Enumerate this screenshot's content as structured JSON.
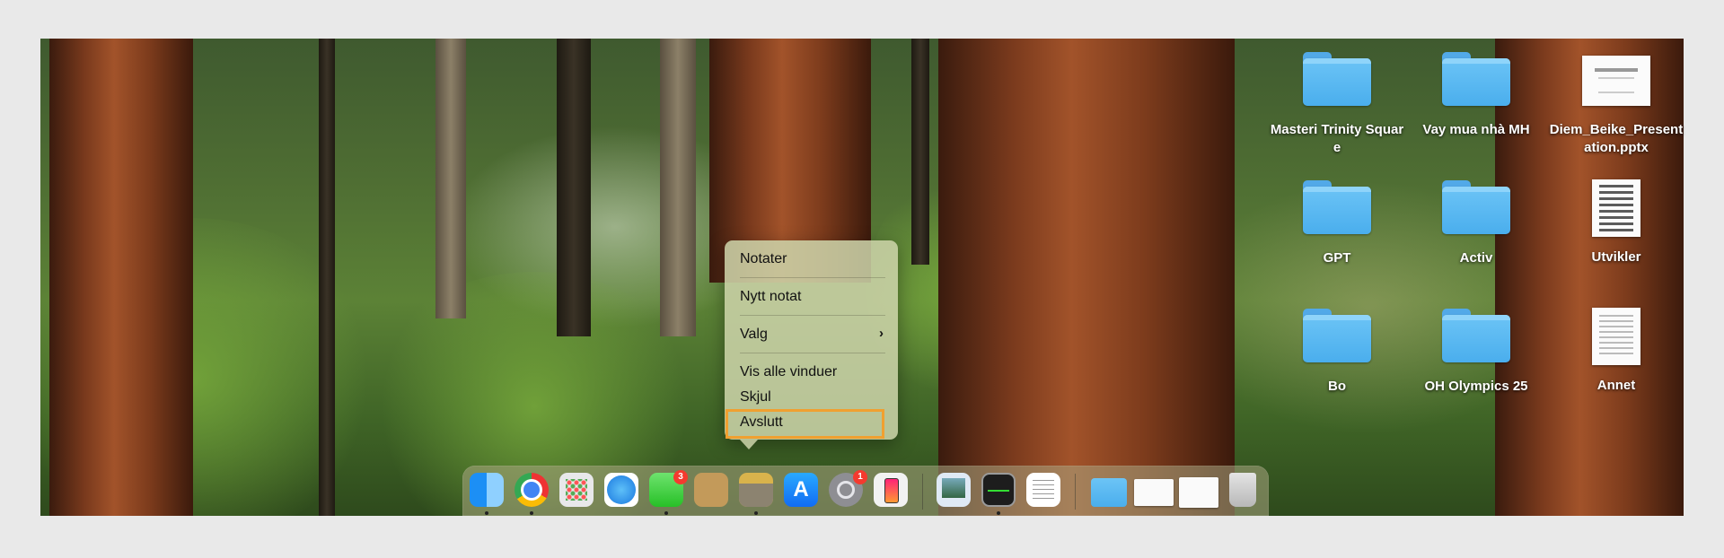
{
  "desktop": {
    "icons": [
      {
        "label": "Masteri Trinity Square",
        "type": "folder-icon"
      },
      {
        "label": "Vay mua nhà MH",
        "type": "folder-icon"
      },
      {
        "label": "Diem_Beike_Presentation.pptx",
        "type": "presentation-file-icon"
      },
      {
        "label": "GPT",
        "type": "folder-icon"
      },
      {
        "label": "Activ",
        "type": "folder-icon"
      },
      {
        "label": "Utvikler",
        "type": "document-stack-icon"
      },
      {
        "label": "Bo",
        "type": "folder-icon"
      },
      {
        "label": "OH Olympics 25",
        "type": "folder-icon"
      },
      {
        "label": "Annet",
        "type": "document-stack-icon"
      }
    ]
  },
  "context_menu": {
    "app": "Notater",
    "new_note": "Nytt notat",
    "options": "Valg",
    "options_chevron": "›",
    "show_all_windows": "Vis alle vinduer",
    "hide": "Skjul",
    "quit": "Avslutt",
    "highlighted_item": "Avslutt",
    "highlight_color": "#f0a030"
  },
  "dock": {
    "apps": [
      {
        "name": "Finder",
        "icon": "finder-icon"
      },
      {
        "name": "Google Chrome",
        "icon": "chrome-icon"
      },
      {
        "name": "Launchpad",
        "icon": "launchpad-icon"
      },
      {
        "name": "Safari",
        "icon": "safari-icon"
      },
      {
        "name": "Messages",
        "icon": "messages-icon",
        "badge": "3"
      },
      {
        "name": "Contacts",
        "icon": "contacts-icon"
      },
      {
        "name": "Notes",
        "icon": "notes-icon"
      },
      {
        "name": "App Store",
        "icon": "app-store-icon",
        "glyph": "A"
      },
      {
        "name": "System Settings",
        "icon": "settings-icon",
        "badge": "1"
      },
      {
        "name": "iPhone Mirroring",
        "icon": "iphone-mirroring-icon"
      },
      {
        "name": "Preview",
        "icon": "preview-icon"
      },
      {
        "name": "Activity Monitor",
        "icon": "activity-monitor-icon"
      },
      {
        "name": "TextEdit",
        "icon": "textedit-icon"
      },
      {
        "name": "Downloads",
        "icon": "downloads-folder-icon"
      },
      {
        "name": "Recent document 1",
        "icon": "document-preview-icon"
      },
      {
        "name": "Recent document 2",
        "icon": "document-preview-icon"
      },
      {
        "name": "Trash",
        "icon": "trash-icon"
      }
    ],
    "badge_color": "#f43a2f"
  }
}
